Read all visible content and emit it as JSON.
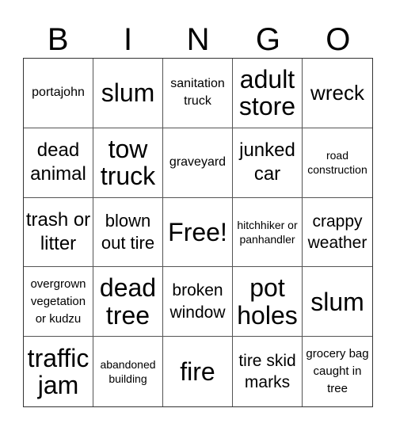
{
  "header": [
    "B",
    "I",
    "N",
    "G",
    "O"
  ],
  "cells": [
    {
      "text": "portajohn",
      "size": "s5"
    },
    {
      "text": "slum",
      "size": "s1"
    },
    {
      "text": "sanitation truck",
      "size": "s5"
    },
    {
      "text": "adult store",
      "size": "s1"
    },
    {
      "text": "wreck",
      "size": "s2"
    },
    {
      "text": "dead animal",
      "size": "s3"
    },
    {
      "text": "tow truck",
      "size": "s1"
    },
    {
      "text": "graveyard",
      "size": "s5"
    },
    {
      "text": "junked car",
      "size": "s3"
    },
    {
      "text": "road construction",
      "size": "s6"
    },
    {
      "text": "trash or litter",
      "size": "s3"
    },
    {
      "text": "blown out tire",
      "size": "s11"
    },
    {
      "text": "Free!",
      "size": "s1"
    },
    {
      "text": "hitchhiker or panhandler",
      "size": "s6"
    },
    {
      "text": "crappy weather",
      "size": "s9"
    },
    {
      "text": "overgrown vegetation or kudzu",
      "size": "s8"
    },
    {
      "text": "dead tree",
      "size": "s1"
    },
    {
      "text": "broken window",
      "size": "s9"
    },
    {
      "text": "pot holes",
      "size": "s1"
    },
    {
      "text": "slum",
      "size": "s1"
    },
    {
      "text": "traffic jam",
      "size": "s1"
    },
    {
      "text": "abandoned building",
      "size": "s6"
    },
    {
      "text": "fire",
      "size": "s1"
    },
    {
      "text": "tire skid marks",
      "size": "s9"
    },
    {
      "text": "grocery bag caught in tree",
      "size": "s8"
    }
  ]
}
